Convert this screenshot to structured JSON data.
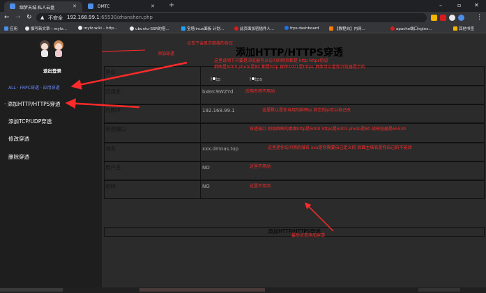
{
  "browser": {
    "tabs": [
      {
        "title": "绵梦天城-私人云盘",
        "favicon_color": "#4f8ee8"
      },
      {
        "title": "DMTC",
        "favicon_color": "#4f8ee8"
      }
    ],
    "new_tab": "+",
    "window_controls": [
      "–",
      "▫",
      "✕"
    ],
    "security_label": "不安全",
    "url_host": "192.168.99.1",
    "url_rest": ":65530/zhanshen.php",
    "bookmarks": [
      {
        "label": "应用",
        "color": "#4f8ee8"
      },
      {
        "label": "撰写新文章 ‹ myfz...",
        "color": "#e8eaed"
      },
      {
        "label": "myfz.wiki – http...",
        "color": "#e8eaed"
      },
      {
        "label": "ubuntu-SSR的搭...",
        "color": "#e8eaed"
      },
      {
        "label": "宝塔linux面板 计划...",
        "color": "#20a0ff"
      },
      {
        "label": "此页面加密插件人...",
        "color": "#d81b1b"
      },
      {
        "label": "frps dashboard",
        "color": "#1a73e8"
      },
      {
        "label": "【教程向】内网...",
        "color": "#ff7a00"
      },
      {
        "label": "apache端口nginx...",
        "color": "#d81b1b"
      },
      {
        "label": "其他书签",
        "color": "#f4b400"
      }
    ]
  },
  "sidebar": {
    "logout": "退出登录",
    "breadcrumb": "ALL · FRPC穿透 · 应用穿透",
    "menu": [
      {
        "label": "添加HTTP/HTTPS穿透",
        "bullet": "·"
      },
      {
        "label": "添加TCP/UDP穿透",
        "bullet": ""
      },
      {
        "label": "修改穿透",
        "bullet": ""
      },
      {
        "label": "删除穿透",
        "bullet": ""
      }
    ]
  },
  "main": {
    "title": "添加HTTP/HTTPS穿透",
    "form": {
      "protocol": {
        "label": "协议",
        "options": [
          "http",
          "https"
        ]
      },
      "app_name": {
        "label": "应用名",
        "value": "bxErc9WZYd"
      },
      "local_ip": {
        "label": "内网IP",
        "value": "192.168.99.1"
      },
      "port": {
        "label": "穿透端口",
        "value": ""
      },
      "domain": {
        "label": "域名",
        "value": "xxx.dmnas.top"
      },
      "username": {
        "label": "用户名",
        "value": "NO"
      },
      "password": {
        "label": "密码",
        "value": "NO"
      }
    },
    "submit": "添加HTTP/HTTPS穿透"
  },
  "annotations": {
    "nav_hint": "点击下会显示链接的协议",
    "add_hint": "添加穿透",
    "protocol_note_1": "这里说明下只要是浏览器可以访问的网页都是 http https协议",
    "protocol_note_2": "群晖是5000 photo是80 都是http 群晖5001是https 具体可以看你浏览器是示的",
    "app_note": "应用名称不用动",
    "ip_note": "这里默认是你当用的群晖ip 其它的ip可以自己改",
    "port_note": "穿透端口 例如群晖的桌面http是5000 https是5001 photo是80 战神容器是65530",
    "domain_note": "这里是你访问用的域名 xxx是你需要自己定义的 后面主域名是你自己的不能动",
    "user_note": "这里不用动",
    "pass_note": "这里不用动",
    "submit_note": "最后点击添加穿透"
  },
  "colors": {
    "annotation": "#ff2a2a",
    "accent": "#6a8cff"
  }
}
